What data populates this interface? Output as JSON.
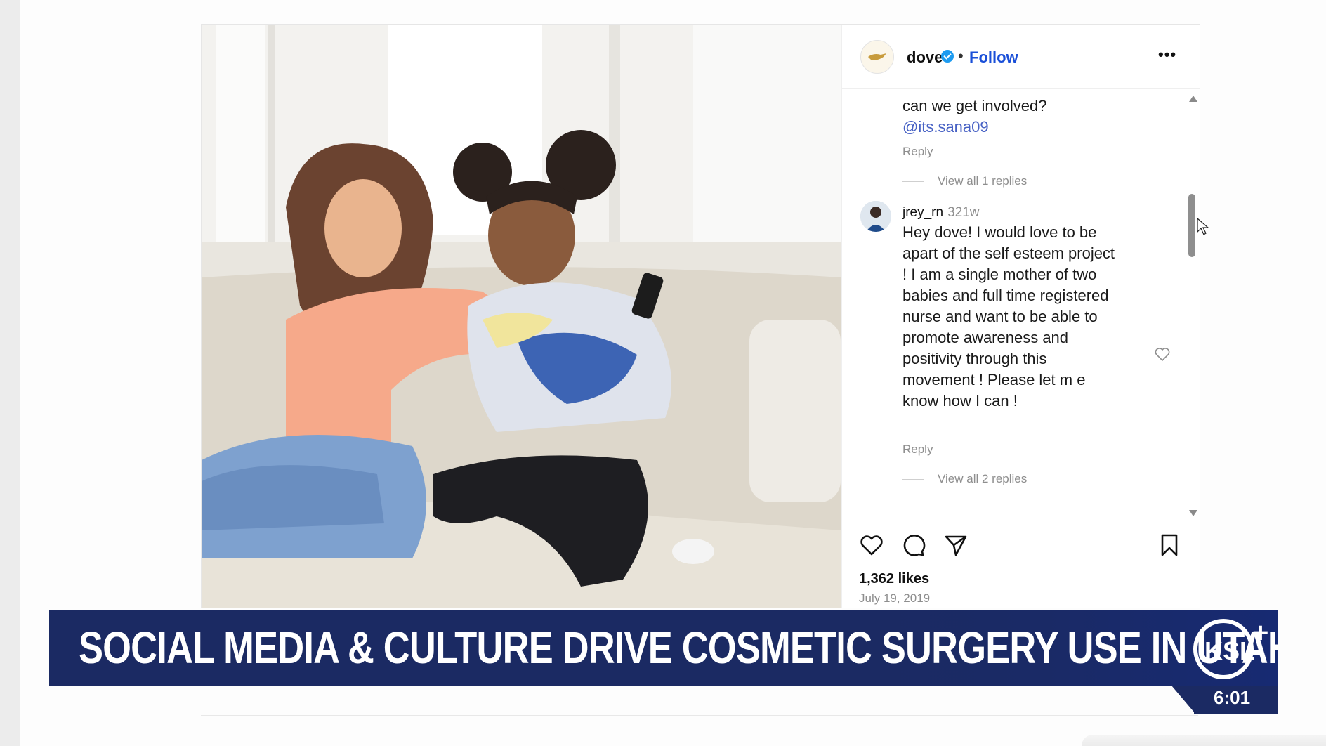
{
  "post": {
    "username": "dove",
    "separator": "•",
    "follow_label": "Follow",
    "more_label": "•••",
    "comments": [
      {
        "partial_text": "can we get involved?",
        "mention": "@its.sana09",
        "reply_label": "Reply",
        "view_replies": "View all 1 replies"
      },
      {
        "user": "jrey_rn",
        "time": "321w",
        "lines": [
          "Hey dove! I would love to be",
          "apart of the self esteem project",
          "! I am a single mother of two",
          "babies and full time registered",
          "nurse and want to be able to",
          "promote awareness and",
          "positivity through this",
          "movement ! Please let m e",
          "know how I can !"
        ],
        "reply_label": "Reply",
        "view_replies": "View all 2 replies"
      }
    ],
    "likes": "1,362 likes",
    "date": "July 19, 2019"
  },
  "banner": {
    "headline": "SOCIAL MEDIA & CULTURE DRIVE COSMETIC SURGERY USE IN UTAH",
    "logo_text": "KSL",
    "logo_plus": "+",
    "clock": "6:01"
  },
  "colors": {
    "banner": "#1b2a63",
    "follow": "#1a4fd8",
    "mention": "#4761c4"
  }
}
